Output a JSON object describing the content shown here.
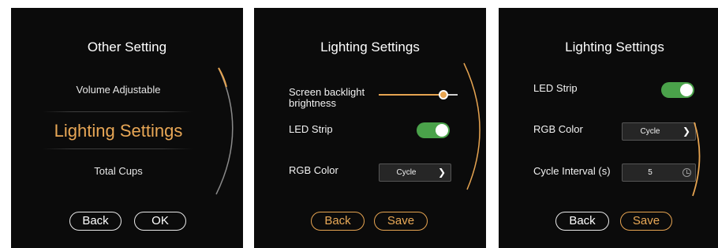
{
  "colors": {
    "accent": "#e6a451",
    "toggle_on": "#4aa24a",
    "panel_bg": "#0b0b0b"
  },
  "panel1": {
    "title": "Other Setting",
    "items": [
      "Volume Adjustable",
      "Lighting Settings",
      "Total Cups"
    ],
    "selected_index": 1,
    "back_label": "Back",
    "ok_label": "OK"
  },
  "panel2": {
    "title": "Lighting Settings",
    "backlight_label": "Screen backlight\nbrightness",
    "backlight_level": 0.82,
    "led_strip_label": "LED Strip",
    "led_strip_on": true,
    "rgb_label": "RGB Color",
    "rgb_value": "Cycle",
    "back_label": "Back",
    "save_label": "Save"
  },
  "panel3": {
    "title": "Lighting Settings",
    "led_strip_label": "LED Strip",
    "led_strip_on": true,
    "rgb_label": "RGB Color",
    "rgb_value": "Cycle",
    "interval_label": "Cycle Interval (s)",
    "interval_value": "5",
    "back_label": "Back",
    "save_label": "Save"
  },
  "icons": {
    "chevron": "chevron-right-icon",
    "timer": "clock-icon",
    "scroll": "scroll-arc-icon"
  }
}
